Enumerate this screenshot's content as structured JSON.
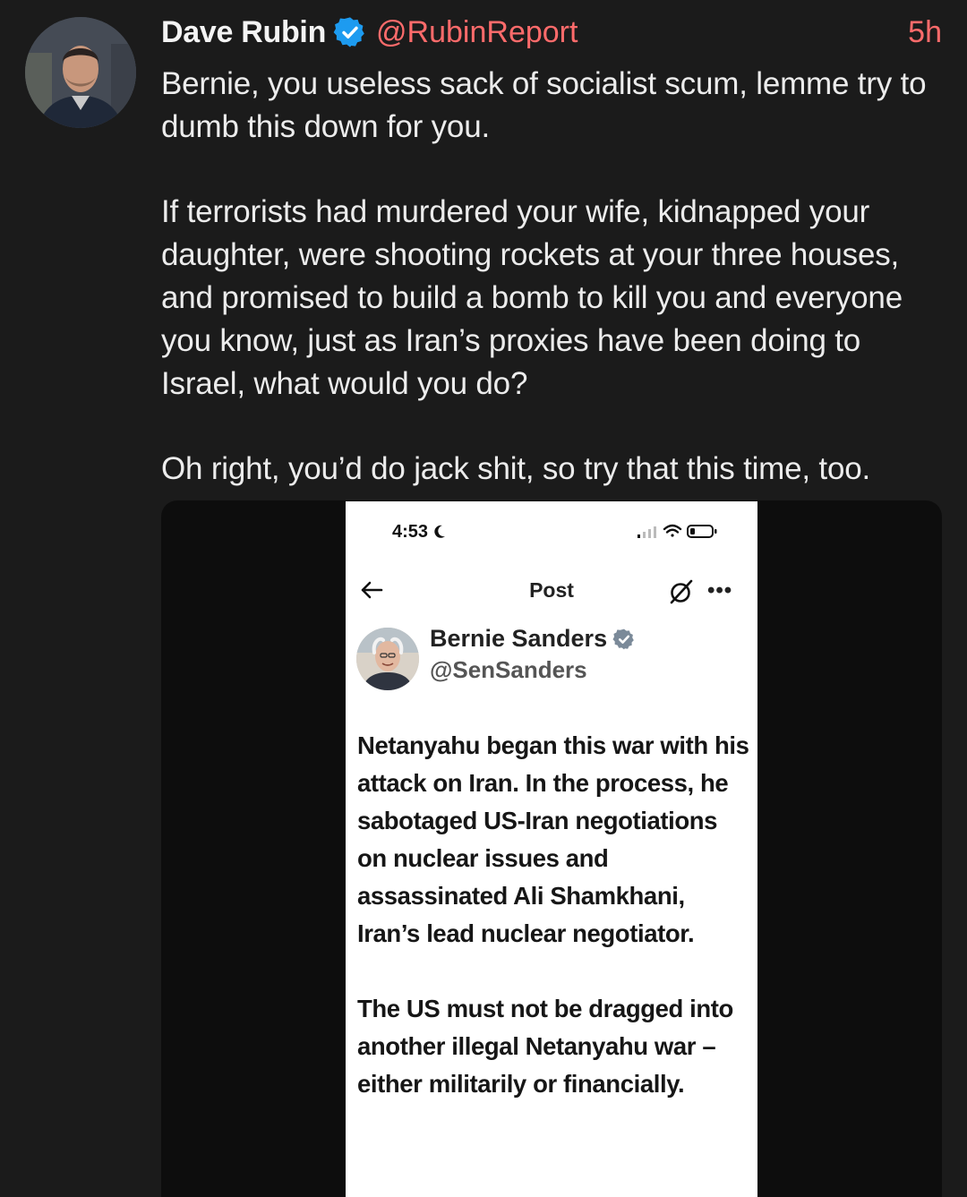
{
  "post": {
    "author_name": "Dave Rubin",
    "author_handle": "@RubinReport",
    "time": "5h",
    "paragraphs": [
      "Bernie, you useless sack of socialist scum, lemme try to dumb this down for you.",
      "If terrorists had murdered your wife, kidnapped your daughter, were shooting rockets at your three houses, and promised to build a bomb to kill you and everyone you know, just as Iran’s proxies have been doing to Israel, what would you do?",
      "Oh right, you’d do jack shit, so try that this time, too."
    ],
    "colors": {
      "background": "#1b1b1b",
      "accent": "#ff6b6b",
      "verified": "#1d9bf0",
      "text": "#ececec"
    },
    "verified_icon": "verified-badge-icon"
  },
  "screenshot": {
    "status_time": "4:53",
    "status_icons": [
      "moon-icon",
      "signal-icon",
      "wifi-icon",
      "battery-icon"
    ],
    "nav_title": "Post",
    "nav_icons": [
      "back-arrow-icon",
      "grok-icon",
      "more-icon"
    ],
    "author_name": "Bernie Sanders",
    "author_handle": "@SenSanders",
    "paragraphs": [
      "Netanyahu began this war with his attack on Iran. In the process, he sabotaged US-Iran negotiations on nuclear issues and assassinated Ali Shamkhani, Iran’s lead nuclear negotiator.",
      "The US must not be dragged into another illegal Netanyahu war – either militarily or financially."
    ]
  }
}
